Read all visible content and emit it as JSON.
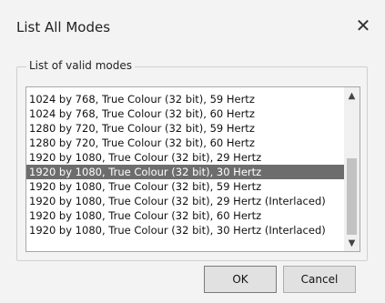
{
  "window": {
    "title": "List All Modes",
    "close_glyph": "✕"
  },
  "group": {
    "label": "List of valid modes"
  },
  "modes": [
    "1024 by 768, True Colour (32 bit), 59 Hertz",
    "1024 by 768, True Colour (32 bit), 60 Hertz",
    "1280 by 720, True Colour (32 bit), 59 Hertz",
    "1280 by 720, True Colour (32 bit), 60 Hertz",
    "1920 by 1080, True Colour (32 bit), 29 Hertz",
    "1920 by 1080, True Colour (32 bit), 30 Hertz",
    "1920 by 1080, True Colour (32 bit), 59 Hertz",
    "1920 by 1080, True Colour (32 bit), 29 Hertz (Interlaced)",
    "1920 by 1080, True Colour (32 bit), 60 Hertz",
    "1920 by 1080, True Colour (32 bit), 30 Hertz (Interlaced)"
  ],
  "selected_index": 5,
  "scrollbar": {
    "up_glyph": "▲",
    "down_glyph": "▼"
  },
  "buttons": {
    "ok": "OK",
    "cancel": "Cancel"
  },
  "colors": {
    "selection": "#6d6d6d",
    "background": "#f3f3f3"
  }
}
